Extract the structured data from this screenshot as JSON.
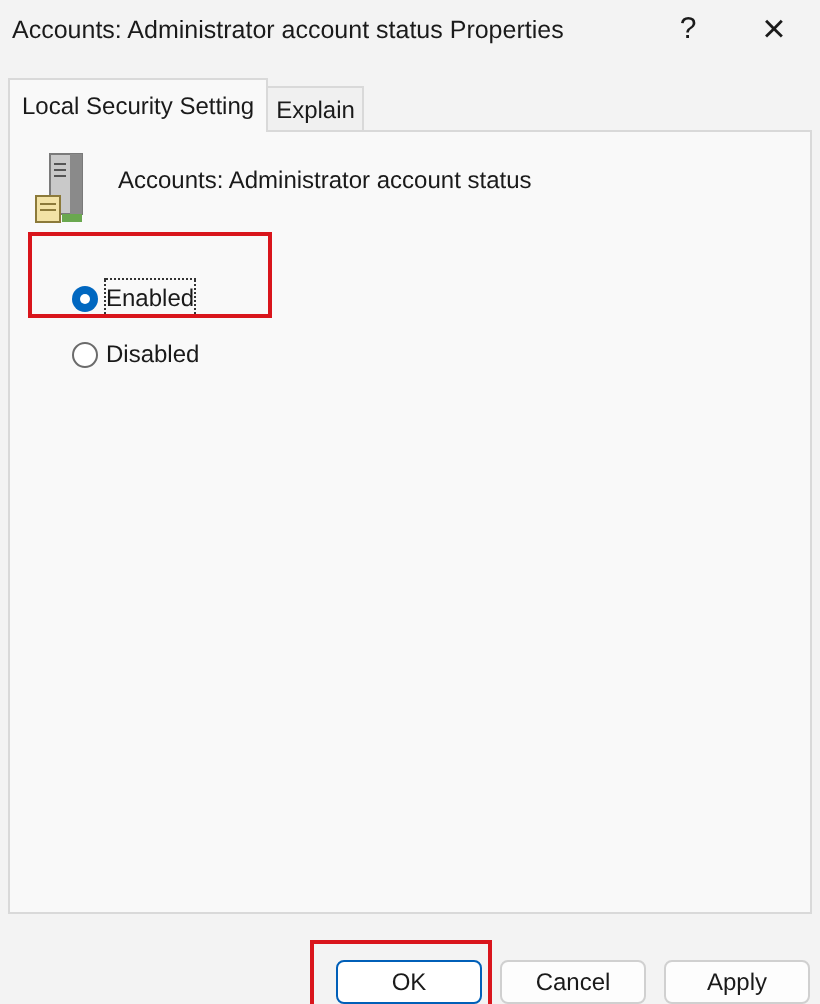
{
  "window": {
    "title": "Accounts: Administrator account status Properties",
    "help": "?",
    "close": "×"
  },
  "tabs": [
    {
      "label": "Local Security Setting",
      "selected": true
    },
    {
      "label": "Explain",
      "selected": false
    }
  ],
  "policy": {
    "name": "Accounts: Administrator account status"
  },
  "options": [
    {
      "label": "Enabled",
      "selected": true,
      "highlighted": true
    },
    {
      "label": "Disabled",
      "selected": false,
      "highlighted": false
    }
  ],
  "buttons": [
    {
      "label": "OK",
      "default": true,
      "highlighted": true
    },
    {
      "label": "Cancel",
      "default": false,
      "highlighted": false
    },
    {
      "label": "Apply",
      "default": false,
      "highlighted": false
    }
  ]
}
